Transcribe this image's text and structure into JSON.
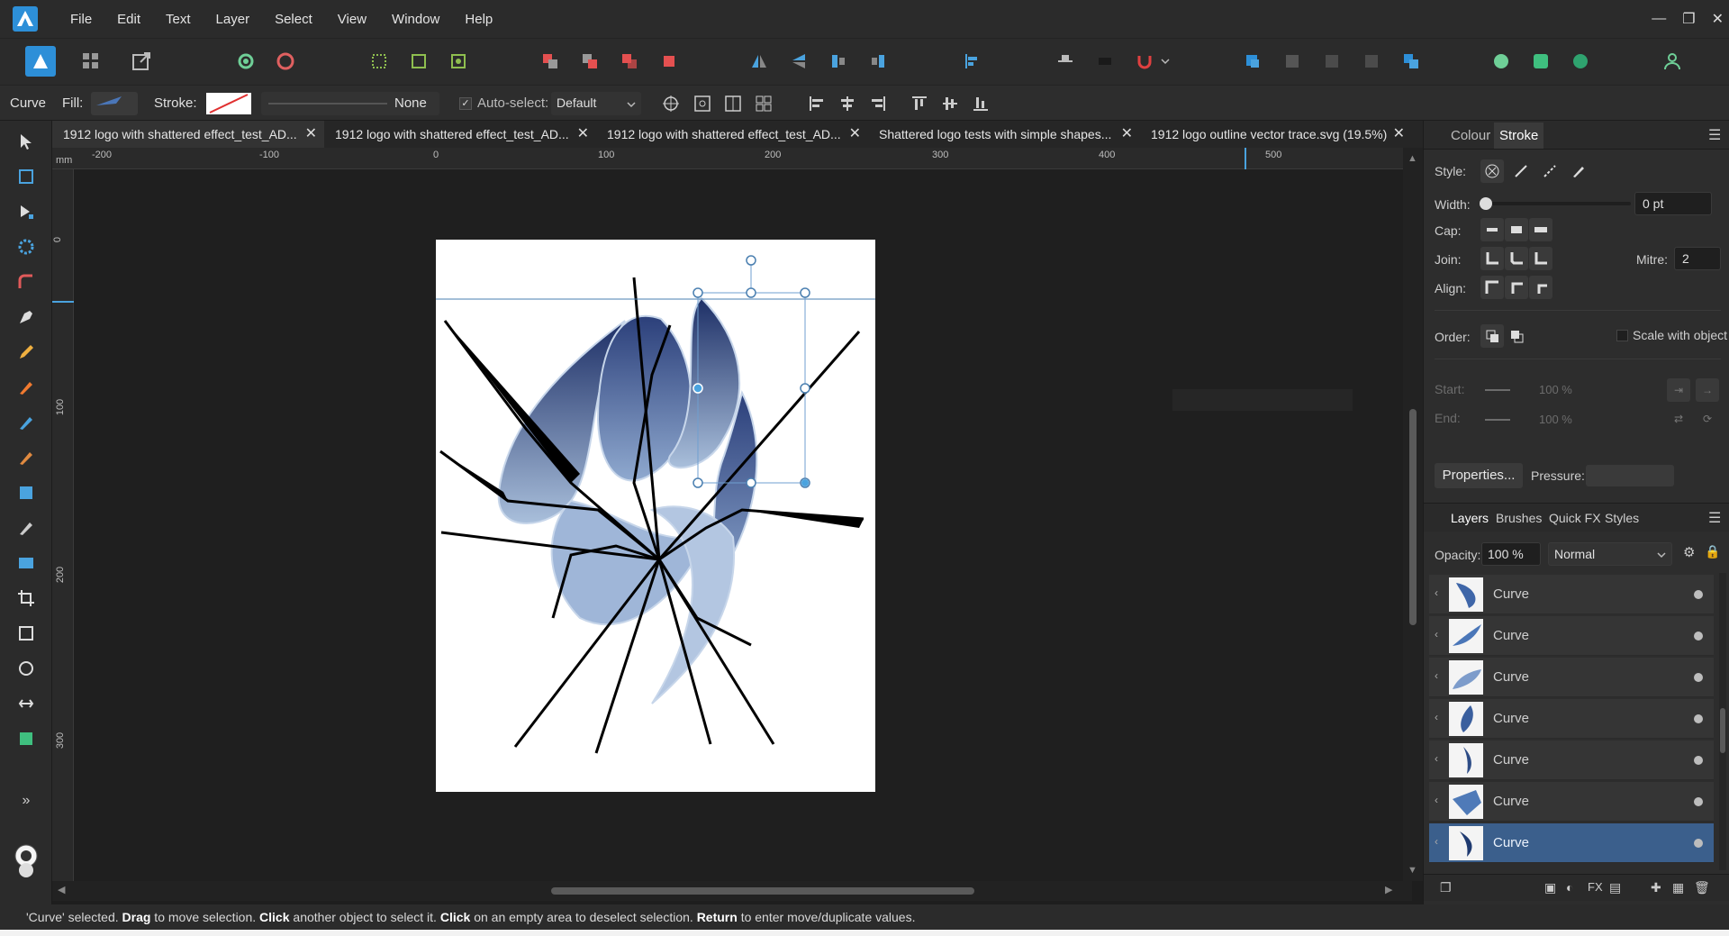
{
  "menu": [
    "File",
    "Edit",
    "Text",
    "Layer",
    "Select",
    "View",
    "Window",
    "Help"
  ],
  "context": {
    "tool_name": "Curve",
    "fill_label": "Fill:",
    "stroke_label": "Stroke:",
    "stroke_style": "None",
    "autoselect_label": "Auto-select:",
    "autoselect_value": "Default"
  },
  "tabs": [
    {
      "label": "1912 logo with shattered effect_test_AD..."
    },
    {
      "label": "1912 logo with shattered effect_test_AD..."
    },
    {
      "label": "1912 logo with shattered effect_test_AD..."
    },
    {
      "label": "Shattered logo tests with simple shapes..."
    },
    {
      "label": "1912 logo outline vector trace.svg (19.5%)"
    }
  ],
  "ruler": {
    "unit": "mm",
    "top_ticks": [
      "-200",
      "-100",
      "0",
      "100",
      "200",
      "300",
      "400",
      "500"
    ],
    "left_ticks": [
      "0",
      "100",
      "200",
      "300"
    ]
  },
  "stroke_panel": {
    "tab_colour": "Colour",
    "tab_stroke": "Stroke",
    "style_label": "Style:",
    "width_label": "Width:",
    "width_value": "0 pt",
    "cap_label": "Cap:",
    "join_label": "Join:",
    "mitre_label": "Mitre:",
    "mitre_value": "2",
    "align_label": "Align:",
    "order_label": "Order:",
    "scale_label": "Scale with object",
    "start_label": "Start:",
    "start_value": "100 %",
    "end_label": "End:",
    "end_value": "100 %",
    "properties_label": "Properties...",
    "pressure_label": "Pressure:"
  },
  "layers_panel": {
    "tab_layers": "Layers",
    "tab_brushes": "Brushes",
    "tab_quickfx": "Quick FX",
    "tab_styles": "Styles",
    "opacity_label": "Opacity:",
    "opacity_value": "100 %",
    "blend_mode": "Normal",
    "layers": [
      {
        "name": "Curve",
        "selected": false
      },
      {
        "name": "Curve",
        "selected": false
      },
      {
        "name": "Curve",
        "selected": false
      },
      {
        "name": "Curve",
        "selected": false
      },
      {
        "name": "Curve",
        "selected": false
      },
      {
        "name": "Curve",
        "selected": false
      },
      {
        "name": "Curve",
        "selected": true
      }
    ]
  },
  "status": {
    "s1": "'Curve' selected. ",
    "k1": "Drag",
    "s2": " to move selection. ",
    "k2": "Click",
    "s3": " another object to select it. ",
    "k3": "Click",
    "s4": " on an empty area to deselect selection. ",
    "k4": "Return",
    "s5": " to enter move/duplicate values."
  },
  "colors": {
    "accent": "#3b5f8c",
    "brand": "#2d8fd8"
  }
}
